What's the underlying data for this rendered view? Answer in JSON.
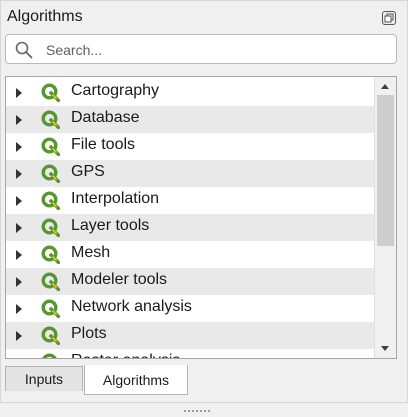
{
  "panel": {
    "title": "Algorithms"
  },
  "search": {
    "placeholder": "Search..."
  },
  "tree": {
    "items": [
      {
        "label": "Cartography",
        "icon": "qgis-icon"
      },
      {
        "label": "Database",
        "icon": "qgis-icon"
      },
      {
        "label": "File tools",
        "icon": "qgis-icon"
      },
      {
        "label": "GPS",
        "icon": "qgis-icon"
      },
      {
        "label": "Interpolation",
        "icon": "qgis-icon"
      },
      {
        "label": "Layer tools",
        "icon": "qgis-icon"
      },
      {
        "label": "Mesh",
        "icon": "qgis-icon"
      },
      {
        "label": "Modeler tools",
        "icon": "qgis-icon"
      },
      {
        "label": "Network analysis",
        "icon": "qgis-icon"
      },
      {
        "label": "Plots",
        "icon": "qgis-icon"
      },
      {
        "label": "Raster analysis",
        "icon": "qgis-icon"
      }
    ],
    "scroll_position": 0
  },
  "tabs": [
    {
      "label": "Inputs",
      "active": false
    },
    {
      "label": "Algorithms",
      "active": true
    }
  ],
  "colors": {
    "qgis_green": "#589632",
    "qgis_yellow": "#eec90d",
    "row_alt": "#e9e9e9"
  }
}
